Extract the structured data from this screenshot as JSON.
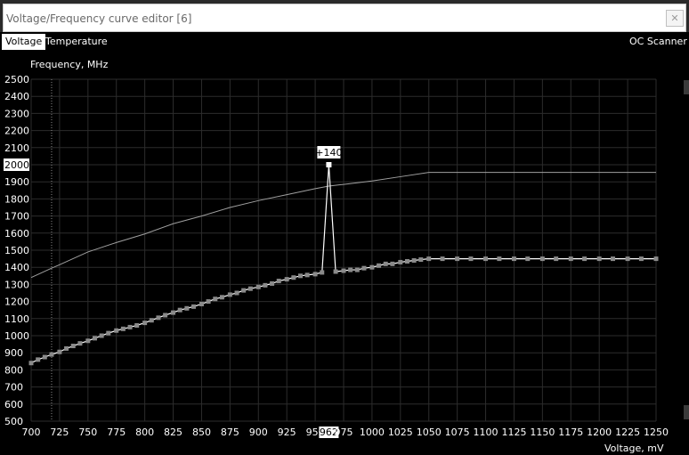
{
  "window": {
    "title": "Voltage/Frequency curve editor [6]",
    "close_glyph": "✕"
  },
  "tabs": {
    "voltage": "Voltage",
    "temperature": "Temperature",
    "oc_scanner": "OC Scanner"
  },
  "colors": {
    "background": "#000000",
    "grid": "#2c2c2c",
    "default_curve": "#a0a0a0",
    "offset_curve": "#8a8a8a",
    "selected": "#ffffff"
  },
  "chart_data": {
    "type": "line",
    "xlabel": "Voltage, mV",
    "ylabel": "Frequency, MHz",
    "xlim": [
      700,
      1250
    ],
    "ylim": [
      500,
      2500
    ],
    "x_ticks": [
      700,
      725,
      750,
      775,
      800,
      825,
      850,
      875,
      900,
      925,
      950,
      962,
      975,
      1000,
      1025,
      1050,
      1075,
      1100,
      1125,
      1150,
      1175,
      1200,
      1225,
      1250
    ],
    "x_tick_labels": [
      "700",
      "725",
      "750",
      "775",
      "800",
      "825",
      "850",
      "875",
      "900",
      "925",
      "950",
      "962",
      "975",
      "1000",
      "1025",
      "1050",
      "1075",
      "1100",
      "1125",
      "1150",
      "1175",
      "1200",
      "1225",
      "1250"
    ],
    "y_ticks": [
      500,
      600,
      700,
      800,
      900,
      1000,
      1100,
      1200,
      1300,
      1400,
      1500,
      1600,
      1700,
      1800,
      1900,
      2000,
      2100,
      2200,
      2300,
      2400,
      2500
    ],
    "y_tick_labels": [
      "500",
      "600",
      "700",
      "800",
      "900",
      "1000",
      "1100",
      "1200",
      "1300",
      "1400",
      "1500",
      "1600",
      "1700",
      "1800",
      "1900",
      "2000",
      "2100",
      "2200",
      "2300",
      "2400",
      "2500"
    ],
    "highlight_x_label": "962",
    "highlight_y_label": "2000",
    "reference_x": 718,
    "series": [
      {
        "x": [
          700,
          718,
          725,
          750,
          775,
          800,
          825,
          850,
          875,
          900,
          925,
          950,
          962,
          975,
          1000,
          1025,
          1050,
          1075,
          1100,
          1125,
          1150,
          1175,
          1200,
          1225,
          1250
        ],
        "y": [
          1340,
          1395,
          1415,
          1490,
          1545,
          1595,
          1655,
          1700,
          1750,
          1790,
          1825,
          1860,
          1875,
          1885,
          1905,
          1930,
          1955,
          1955,
          1955,
          1955,
          1955,
          1955,
          1955,
          1955,
          1955
        ]
      },
      {
        "x": [
          700,
          706,
          712,
          718,
          725,
          731,
          737,
          743,
          750,
          756,
          762,
          768,
          775,
          781,
          787,
          793,
          800,
          806,
          812,
          818,
          825,
          831,
          837,
          843,
          850,
          856,
          862,
          868,
          875,
          881,
          887,
          893,
          900,
          906,
          912,
          918,
          925,
          931,
          937,
          943,
          950,
          956,
          962,
          968,
          975,
          981,
          987,
          993,
          1000,
          1006,
          1012,
          1018,
          1025,
          1031,
          1037,
          1043,
          1050,
          1062,
          1075,
          1087,
          1100,
          1112,
          1125,
          1137,
          1150,
          1162,
          1175,
          1187,
          1200,
          1212,
          1225,
          1237,
          1250
        ],
        "y": [
          840,
          860,
          875,
          890,
          905,
          925,
          940,
          955,
          970,
          985,
          1000,
          1015,
          1030,
          1040,
          1050,
          1060,
          1075,
          1090,
          1105,
          1120,
          1135,
          1150,
          1160,
          1170,
          1185,
          1200,
          1215,
          1225,
          1240,
          1250,
          1265,
          1275,
          1285,
          1295,
          1305,
          1320,
          1330,
          1340,
          1350,
          1355,
          1360,
          1370,
          2000,
          1375,
          1380,
          1385,
          1385,
          1395,
          1400,
          1410,
          1420,
          1420,
          1430,
          1435,
          1440,
          1445,
          1450,
          1450,
          1450,
          1450,
          1450,
          1450,
          1450,
          1450,
          1450,
          1450,
          1450,
          1450,
          1450,
          1450,
          1450,
          1450,
          1450
        ]
      }
    ],
    "annotations": [
      {
        "x": 962,
        "y": 2000,
        "text": "+140"
      }
    ]
  }
}
